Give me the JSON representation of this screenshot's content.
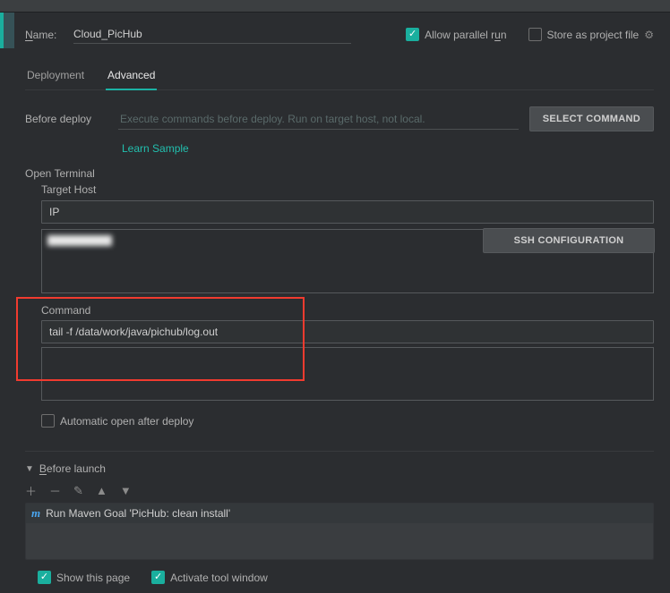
{
  "header": {
    "name_label_pre": "N",
    "name_label_rest": "ame:",
    "name_value": "Cloud_PicHub",
    "allow_pre": "Allow parallel r",
    "allow_u": "u",
    "allow_post": "n",
    "store_label": "Store as project file"
  },
  "tabs": {
    "deployment": "Deployment",
    "advanced": "Advanced"
  },
  "before_deploy": {
    "label": "Before deploy",
    "placeholder": "Execute commands before deploy. Run on target host, not local.",
    "select_command": "SELECT COMMAND",
    "learn_sample": "Learn Sample"
  },
  "terminal": {
    "open_label": "Open Terminal",
    "target_host_label": "Target Host",
    "ip_value": "IP",
    "ssh_button": "SSH CONFIGURATION",
    "command_label": "Command",
    "command_value": "tail -f /data/work/java/pichub/log.out",
    "auto_open": "Automatic open after deploy"
  },
  "before_launch": {
    "title_pre": "B",
    "title_rest": "efore launch",
    "task": "Run Maven Goal 'PicHub: clean install'",
    "show_page": "Show this page",
    "activate_window": "Activate tool window"
  }
}
